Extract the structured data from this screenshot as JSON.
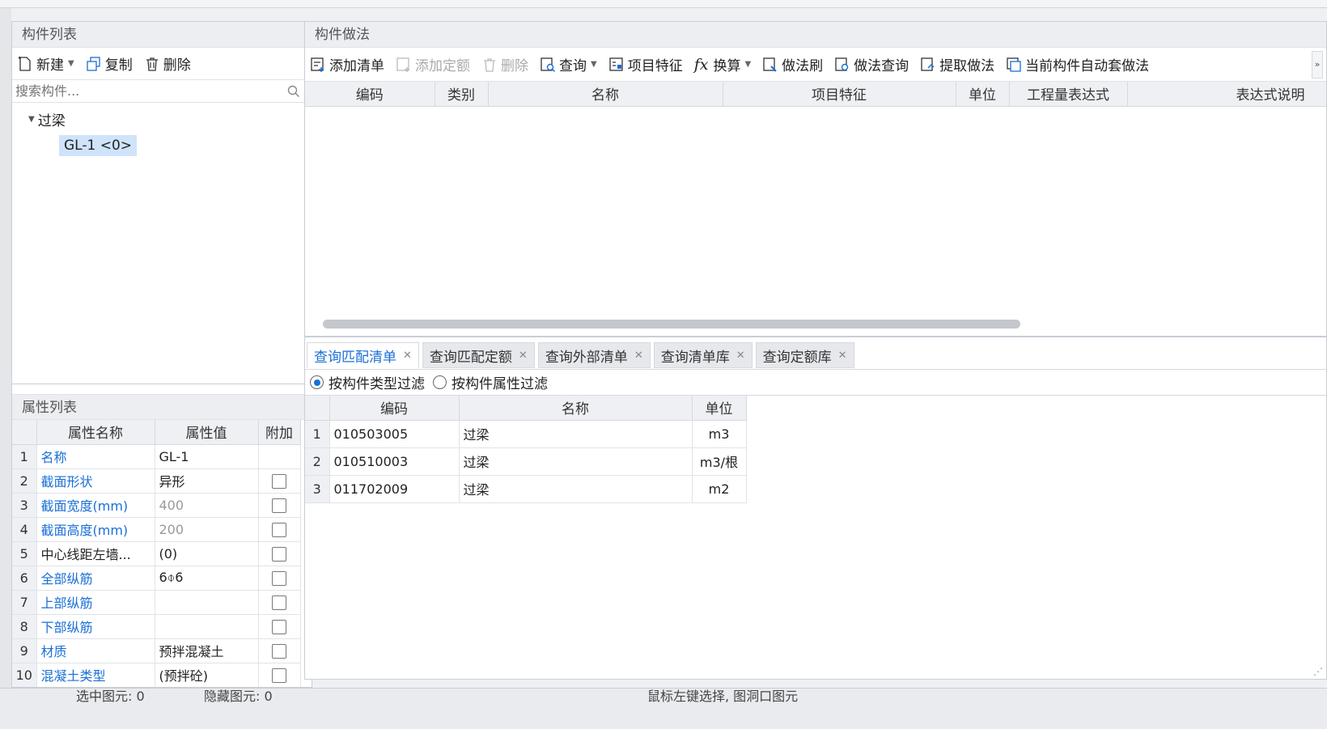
{
  "component_list": {
    "title": "构件列表",
    "toolbar": {
      "new_label": "新建",
      "copy_label": "复制",
      "delete_label": "删除"
    },
    "search_placeholder": "搜索构件...",
    "tree": {
      "group_label": "过梁",
      "item_label": "GL-1 <0>"
    }
  },
  "property_list": {
    "title": "属性列表",
    "headers": [
      "属性名称",
      "属性值",
      "附加"
    ],
    "rows": [
      {
        "no": "1",
        "name": "名称",
        "value": "GL-1",
        "name_blue": true,
        "value_gray": false,
        "has_check": false
      },
      {
        "no": "2",
        "name": "截面形状",
        "value": "异形",
        "name_blue": true,
        "value_gray": false,
        "has_check": true
      },
      {
        "no": "3",
        "name": "截面宽度(mm)",
        "value": "400",
        "name_blue": true,
        "value_gray": true,
        "has_check": true
      },
      {
        "no": "4",
        "name": "截面高度(mm)",
        "value": "200",
        "name_blue": true,
        "value_gray": true,
        "has_check": true
      },
      {
        "no": "5",
        "name": "中心线距左墙...",
        "value": "(0)",
        "name_blue": false,
        "value_gray": false,
        "has_check": true
      },
      {
        "no": "6",
        "name": "全部纵筋",
        "value": "6⌽6",
        "name_blue": true,
        "value_gray": false,
        "has_check": true
      },
      {
        "no": "7",
        "name": "上部纵筋",
        "value": "",
        "name_blue": true,
        "value_gray": false,
        "has_check": true
      },
      {
        "no": "8",
        "name": "下部纵筋",
        "value": "",
        "name_blue": true,
        "value_gray": false,
        "has_check": true
      },
      {
        "no": "9",
        "name": "材质",
        "value": "预拌混凝土",
        "name_blue": true,
        "value_gray": false,
        "has_check": true
      },
      {
        "no": "10",
        "name": "混凝土类型",
        "value": "(预拌砼)",
        "name_blue": true,
        "value_gray": false,
        "has_check": true
      }
    ]
  },
  "method_panel": {
    "title": "构件做法",
    "toolbar": {
      "add_list": "添加清单",
      "add_quota": "添加定额",
      "delete": "删除",
      "query": "查询",
      "item_feature": "项目特征",
      "convert": "换算",
      "method_brush": "做法刷",
      "method_query": "做法查询",
      "extract_method": "提取做法",
      "auto_apply": "当前构件自动套做法"
    },
    "headers": [
      "编码",
      "类别",
      "名称",
      "项目特征",
      "单位",
      "工程量表达式",
      "表达式说明"
    ]
  },
  "query_panel": {
    "tabs": [
      "查询匹配清单",
      "查询匹配定额",
      "查询外部清单",
      "查询清单库",
      "查询定额库"
    ],
    "filter_by_type": "按构件类型过滤",
    "filter_by_attr": "按构件属性过滤",
    "headers": [
      "编码",
      "名称",
      "单位"
    ],
    "rows": [
      {
        "no": "1",
        "code": "010503005",
        "name": "过梁",
        "unit": "m3"
      },
      {
        "no": "2",
        "code": "010510003",
        "name": "过梁",
        "unit": "m3/根"
      },
      {
        "no": "3",
        "code": "011702009",
        "name": "过梁",
        "unit": "m2"
      }
    ]
  },
  "status_bar": {
    "selected": "选中图元: 0",
    "hidden": "隐藏图元: 0",
    "hint": "鼠标左键选择, 图洞口图元"
  }
}
